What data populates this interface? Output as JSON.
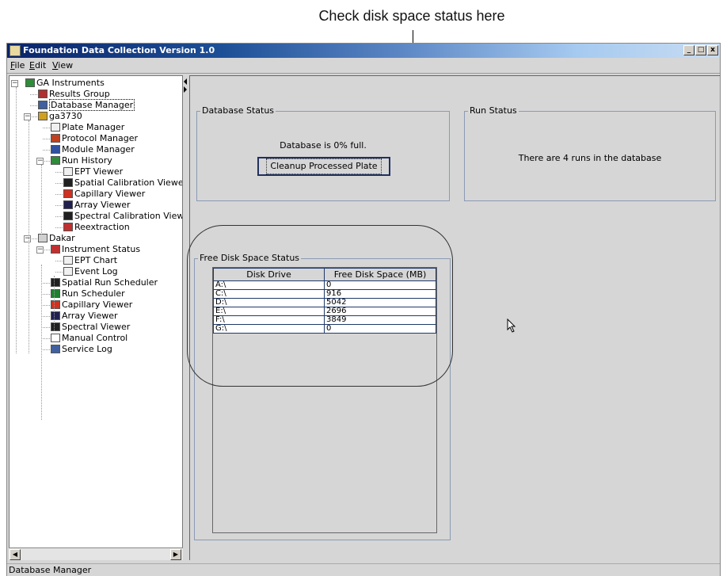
{
  "callout": {
    "text": "Check disk space status here"
  },
  "window": {
    "title": "Foundation Data Collection Version 1.0",
    "buttons": [
      "_",
      "□",
      "x"
    ]
  },
  "menu": [
    "File",
    "Edit",
    "View"
  ],
  "tree": [
    {
      "label": "GA Instruments",
      "icon": "flask-icon",
      "color": "#2e8b3a"
    },
    {
      "label": "Results Group",
      "icon": "results-group-icon",
      "color": "#b03030"
    },
    {
      "label": "Database Manager",
      "icon": "database-icon",
      "color": "#4060a0"
    },
    {
      "label": "ga3730",
      "icon": "instrument-icon",
      "color": "#d0a020"
    },
    {
      "label": "Plate Manager",
      "icon": "plate-icon",
      "color": "#f0f0f0"
    },
    {
      "label": "Protocol Manager",
      "icon": "protocol-icon",
      "color": "#c04020"
    },
    {
      "label": "Module Manager",
      "icon": "module-icon",
      "color": "#3050a0"
    },
    {
      "label": "Run History",
      "icon": "run-history-icon",
      "color": "#2e8b3a"
    },
    {
      "label": "EPT Viewer",
      "icon": "ept-chart-icon",
      "color": "#f0f0f0"
    },
    {
      "label": "Spatial Calibration Viewer",
      "icon": "spatial-calibration-icon",
      "color": "#202020"
    },
    {
      "label": "Capillary Viewer",
      "icon": "capillary-icon",
      "color": "#d03020"
    },
    {
      "label": "Array Viewer",
      "icon": "array-icon",
      "color": "#202050"
    },
    {
      "label": "Spectral Calibration Viewer",
      "icon": "spectral-icon",
      "color": "#202020"
    },
    {
      "label": "Reextraction",
      "icon": "reextraction-icon",
      "color": "#c03030"
    },
    {
      "label": "Dakar",
      "icon": "instrument-icon",
      "color": "#d0d0d0"
    },
    {
      "label": "Instrument Status",
      "icon": "instrument-status-icon",
      "color": "#c03030"
    },
    {
      "label": "EPT Chart",
      "icon": "ept-chart-icon",
      "color": "#f0f0f0"
    },
    {
      "label": "Event Log",
      "icon": "event-log-icon",
      "color": "#f0f0f0"
    },
    {
      "label": "Spatial Run Scheduler",
      "icon": "spatial-calibration-icon",
      "color": "#202020"
    },
    {
      "label": "Run Scheduler",
      "icon": "run-scheduler-icon",
      "color": "#208030"
    },
    {
      "label": "Capillary Viewer",
      "icon": "capillary-icon",
      "color": "#d03020"
    },
    {
      "label": "Array Viewer",
      "icon": "array-icon",
      "color": "#202050"
    },
    {
      "label": "Spectral Viewer",
      "icon": "spectral-icon",
      "color": "#202020"
    },
    {
      "label": "Manual Control",
      "icon": "hand-icon",
      "color": "#ffffff"
    },
    {
      "label": "Service Log",
      "icon": "service-log-icon",
      "color": "#4060a0"
    }
  ],
  "database_status": {
    "title": "Database Status",
    "message": "Database is 0% full.",
    "button": "Cleanup Processed Plate"
  },
  "run_status": {
    "title": "Run Status",
    "message": "There are 4 runs in the database"
  },
  "disk_status": {
    "title": "Free Disk Space Status",
    "headers": [
      "Disk Drive",
      "Free Disk Space (MB)"
    ],
    "rows": [
      [
        "A:\\",
        "0"
      ],
      [
        "C:\\",
        "916"
      ],
      [
        "D:\\",
        "5042"
      ],
      [
        "E:\\",
        "2696"
      ],
      [
        "F:\\",
        "3849"
      ],
      [
        "G:\\",
        "0"
      ]
    ]
  },
  "status_bar": {
    "text": "Database Manager"
  }
}
